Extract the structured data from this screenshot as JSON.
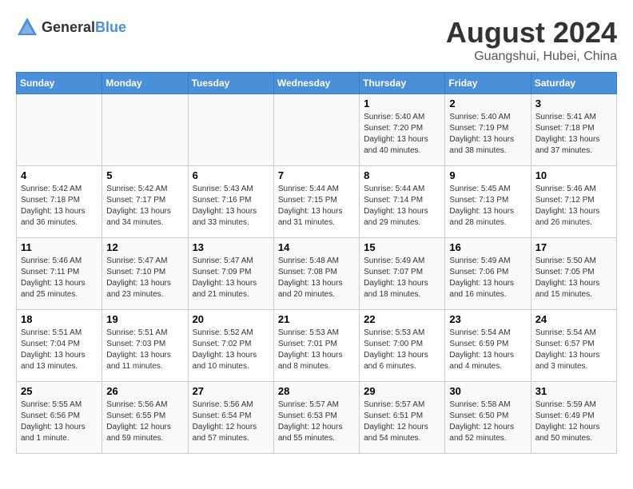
{
  "header": {
    "logo_general": "General",
    "logo_blue": "Blue",
    "month_year": "August 2024",
    "location": "Guangshui, Hubei, China"
  },
  "weekdays": [
    "Sunday",
    "Monday",
    "Tuesday",
    "Wednesday",
    "Thursday",
    "Friday",
    "Saturday"
  ],
  "weeks": [
    [
      {
        "day": "",
        "sunrise": "",
        "sunset": "",
        "daylight": ""
      },
      {
        "day": "",
        "sunrise": "",
        "sunset": "",
        "daylight": ""
      },
      {
        "day": "",
        "sunrise": "",
        "sunset": "",
        "daylight": ""
      },
      {
        "day": "",
        "sunrise": "",
        "sunset": "",
        "daylight": ""
      },
      {
        "day": "1",
        "sunrise": "Sunrise: 5:40 AM",
        "sunset": "Sunset: 7:20 PM",
        "daylight": "Daylight: 13 hours and 40 minutes."
      },
      {
        "day": "2",
        "sunrise": "Sunrise: 5:40 AM",
        "sunset": "Sunset: 7:19 PM",
        "daylight": "Daylight: 13 hours and 38 minutes."
      },
      {
        "day": "3",
        "sunrise": "Sunrise: 5:41 AM",
        "sunset": "Sunset: 7:18 PM",
        "daylight": "Daylight: 13 hours and 37 minutes."
      }
    ],
    [
      {
        "day": "4",
        "sunrise": "Sunrise: 5:42 AM",
        "sunset": "Sunset: 7:18 PM",
        "daylight": "Daylight: 13 hours and 36 minutes."
      },
      {
        "day": "5",
        "sunrise": "Sunrise: 5:42 AM",
        "sunset": "Sunset: 7:17 PM",
        "daylight": "Daylight: 13 hours and 34 minutes."
      },
      {
        "day": "6",
        "sunrise": "Sunrise: 5:43 AM",
        "sunset": "Sunset: 7:16 PM",
        "daylight": "Daylight: 13 hours and 33 minutes."
      },
      {
        "day": "7",
        "sunrise": "Sunrise: 5:44 AM",
        "sunset": "Sunset: 7:15 PM",
        "daylight": "Daylight: 13 hours and 31 minutes."
      },
      {
        "day": "8",
        "sunrise": "Sunrise: 5:44 AM",
        "sunset": "Sunset: 7:14 PM",
        "daylight": "Daylight: 13 hours and 29 minutes."
      },
      {
        "day": "9",
        "sunrise": "Sunrise: 5:45 AM",
        "sunset": "Sunset: 7:13 PM",
        "daylight": "Daylight: 13 hours and 28 minutes."
      },
      {
        "day": "10",
        "sunrise": "Sunrise: 5:46 AM",
        "sunset": "Sunset: 7:12 PM",
        "daylight": "Daylight: 13 hours and 26 minutes."
      }
    ],
    [
      {
        "day": "11",
        "sunrise": "Sunrise: 5:46 AM",
        "sunset": "Sunset: 7:11 PM",
        "daylight": "Daylight: 13 hours and 25 minutes."
      },
      {
        "day": "12",
        "sunrise": "Sunrise: 5:47 AM",
        "sunset": "Sunset: 7:10 PM",
        "daylight": "Daylight: 13 hours and 23 minutes."
      },
      {
        "day": "13",
        "sunrise": "Sunrise: 5:47 AM",
        "sunset": "Sunset: 7:09 PM",
        "daylight": "Daylight: 13 hours and 21 minutes."
      },
      {
        "day": "14",
        "sunrise": "Sunrise: 5:48 AM",
        "sunset": "Sunset: 7:08 PM",
        "daylight": "Daylight: 13 hours and 20 minutes."
      },
      {
        "day": "15",
        "sunrise": "Sunrise: 5:49 AM",
        "sunset": "Sunset: 7:07 PM",
        "daylight": "Daylight: 13 hours and 18 minutes."
      },
      {
        "day": "16",
        "sunrise": "Sunrise: 5:49 AM",
        "sunset": "Sunset: 7:06 PM",
        "daylight": "Daylight: 13 hours and 16 minutes."
      },
      {
        "day": "17",
        "sunrise": "Sunrise: 5:50 AM",
        "sunset": "Sunset: 7:05 PM",
        "daylight": "Daylight: 13 hours and 15 minutes."
      }
    ],
    [
      {
        "day": "18",
        "sunrise": "Sunrise: 5:51 AM",
        "sunset": "Sunset: 7:04 PM",
        "daylight": "Daylight: 13 hours and 13 minutes."
      },
      {
        "day": "19",
        "sunrise": "Sunrise: 5:51 AM",
        "sunset": "Sunset: 7:03 PM",
        "daylight": "Daylight: 13 hours and 11 minutes."
      },
      {
        "day": "20",
        "sunrise": "Sunrise: 5:52 AM",
        "sunset": "Sunset: 7:02 PM",
        "daylight": "Daylight: 13 hours and 10 minutes."
      },
      {
        "day": "21",
        "sunrise": "Sunrise: 5:53 AM",
        "sunset": "Sunset: 7:01 PM",
        "daylight": "Daylight: 13 hours and 8 minutes."
      },
      {
        "day": "22",
        "sunrise": "Sunrise: 5:53 AM",
        "sunset": "Sunset: 7:00 PM",
        "daylight": "Daylight: 13 hours and 6 minutes."
      },
      {
        "day": "23",
        "sunrise": "Sunrise: 5:54 AM",
        "sunset": "Sunset: 6:59 PM",
        "daylight": "Daylight: 13 hours and 4 minutes."
      },
      {
        "day": "24",
        "sunrise": "Sunrise: 5:54 AM",
        "sunset": "Sunset: 6:57 PM",
        "daylight": "Daylight: 13 hours and 3 minutes."
      }
    ],
    [
      {
        "day": "25",
        "sunrise": "Sunrise: 5:55 AM",
        "sunset": "Sunset: 6:56 PM",
        "daylight": "Daylight: 13 hours and 1 minute."
      },
      {
        "day": "26",
        "sunrise": "Sunrise: 5:56 AM",
        "sunset": "Sunset: 6:55 PM",
        "daylight": "Daylight: 12 hours and 59 minutes."
      },
      {
        "day": "27",
        "sunrise": "Sunrise: 5:56 AM",
        "sunset": "Sunset: 6:54 PM",
        "daylight": "Daylight: 12 hours and 57 minutes."
      },
      {
        "day": "28",
        "sunrise": "Sunrise: 5:57 AM",
        "sunset": "Sunset: 6:53 PM",
        "daylight": "Daylight: 12 hours and 55 minutes."
      },
      {
        "day": "29",
        "sunrise": "Sunrise: 5:57 AM",
        "sunset": "Sunset: 6:51 PM",
        "daylight": "Daylight: 12 hours and 54 minutes."
      },
      {
        "day": "30",
        "sunrise": "Sunrise: 5:58 AM",
        "sunset": "Sunset: 6:50 PM",
        "daylight": "Daylight: 12 hours and 52 minutes."
      },
      {
        "day": "31",
        "sunrise": "Sunrise: 5:59 AM",
        "sunset": "Sunset: 6:49 PM",
        "daylight": "Daylight: 12 hours and 50 minutes."
      }
    ]
  ]
}
